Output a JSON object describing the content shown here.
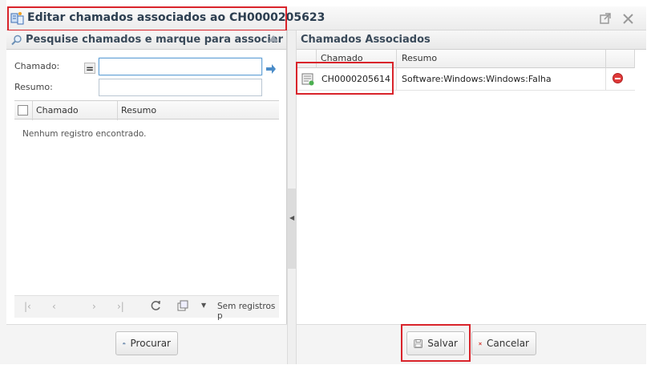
{
  "window": {
    "title": "Editar chamados associados ao CH0000205623"
  },
  "search_panel": {
    "title": "Pesquise chamados e marque para associar",
    "chamado_label": "Chamado:",
    "operator": "=",
    "chamado_value": "",
    "resumo_label": "Resumo:",
    "resumo_value": "",
    "grid_columns": [
      "Chamado",
      "Resumo"
    ],
    "empty_message": "Nenhum registro encontrado.",
    "pager_status": "Sem registros p",
    "search_button": "Procurar"
  },
  "associated_panel": {
    "title": "Chamados Associados",
    "grid_columns": [
      "Chamado",
      "Resumo"
    ],
    "rows": [
      {
        "chamado": "CH0000205614",
        "resumo": "Software:Windows:Windows:Falha"
      }
    ]
  },
  "footer": {
    "save_button": "Salvar",
    "cancel_button": "Cancelar"
  },
  "colors": {
    "highlight_red": "#d9242b",
    "header_text": "#3a4a5a",
    "remove_red": "#e03a3a"
  }
}
